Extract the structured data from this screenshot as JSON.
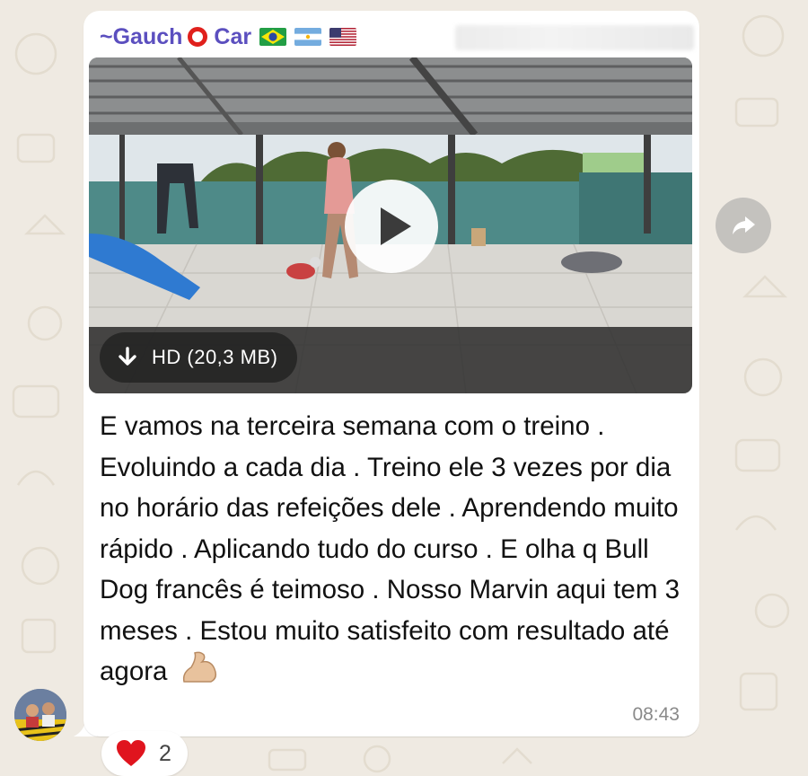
{
  "sender": {
    "name_prefix": "~Gauch",
    "name_suffix": "Car",
    "flags": [
      "brazil-flag",
      "argentina-flag",
      "usa-flag"
    ]
  },
  "video": {
    "download_label": "HD (20,3 MB)"
  },
  "message": {
    "text": "E vamos na terceira semana com o treino . Evoluindo a cada dia . Treino ele 3 vezes por dia no horário das refeições dele . Aprendendo muito rápido . Aplicando tudo do curso . E olha q Bull Dog francês é teimoso . Nosso Marvin aqui tem 3 meses . Estou muito satisfeito com resultado até agora",
    "emoji": "flexed-biceps",
    "time": "08:43"
  },
  "reaction": {
    "emoji": "red-heart",
    "count": "2"
  },
  "colors": {
    "sender_name": "#5b4fbf",
    "background": "#efeae2",
    "bubble": "#ffffff"
  }
}
